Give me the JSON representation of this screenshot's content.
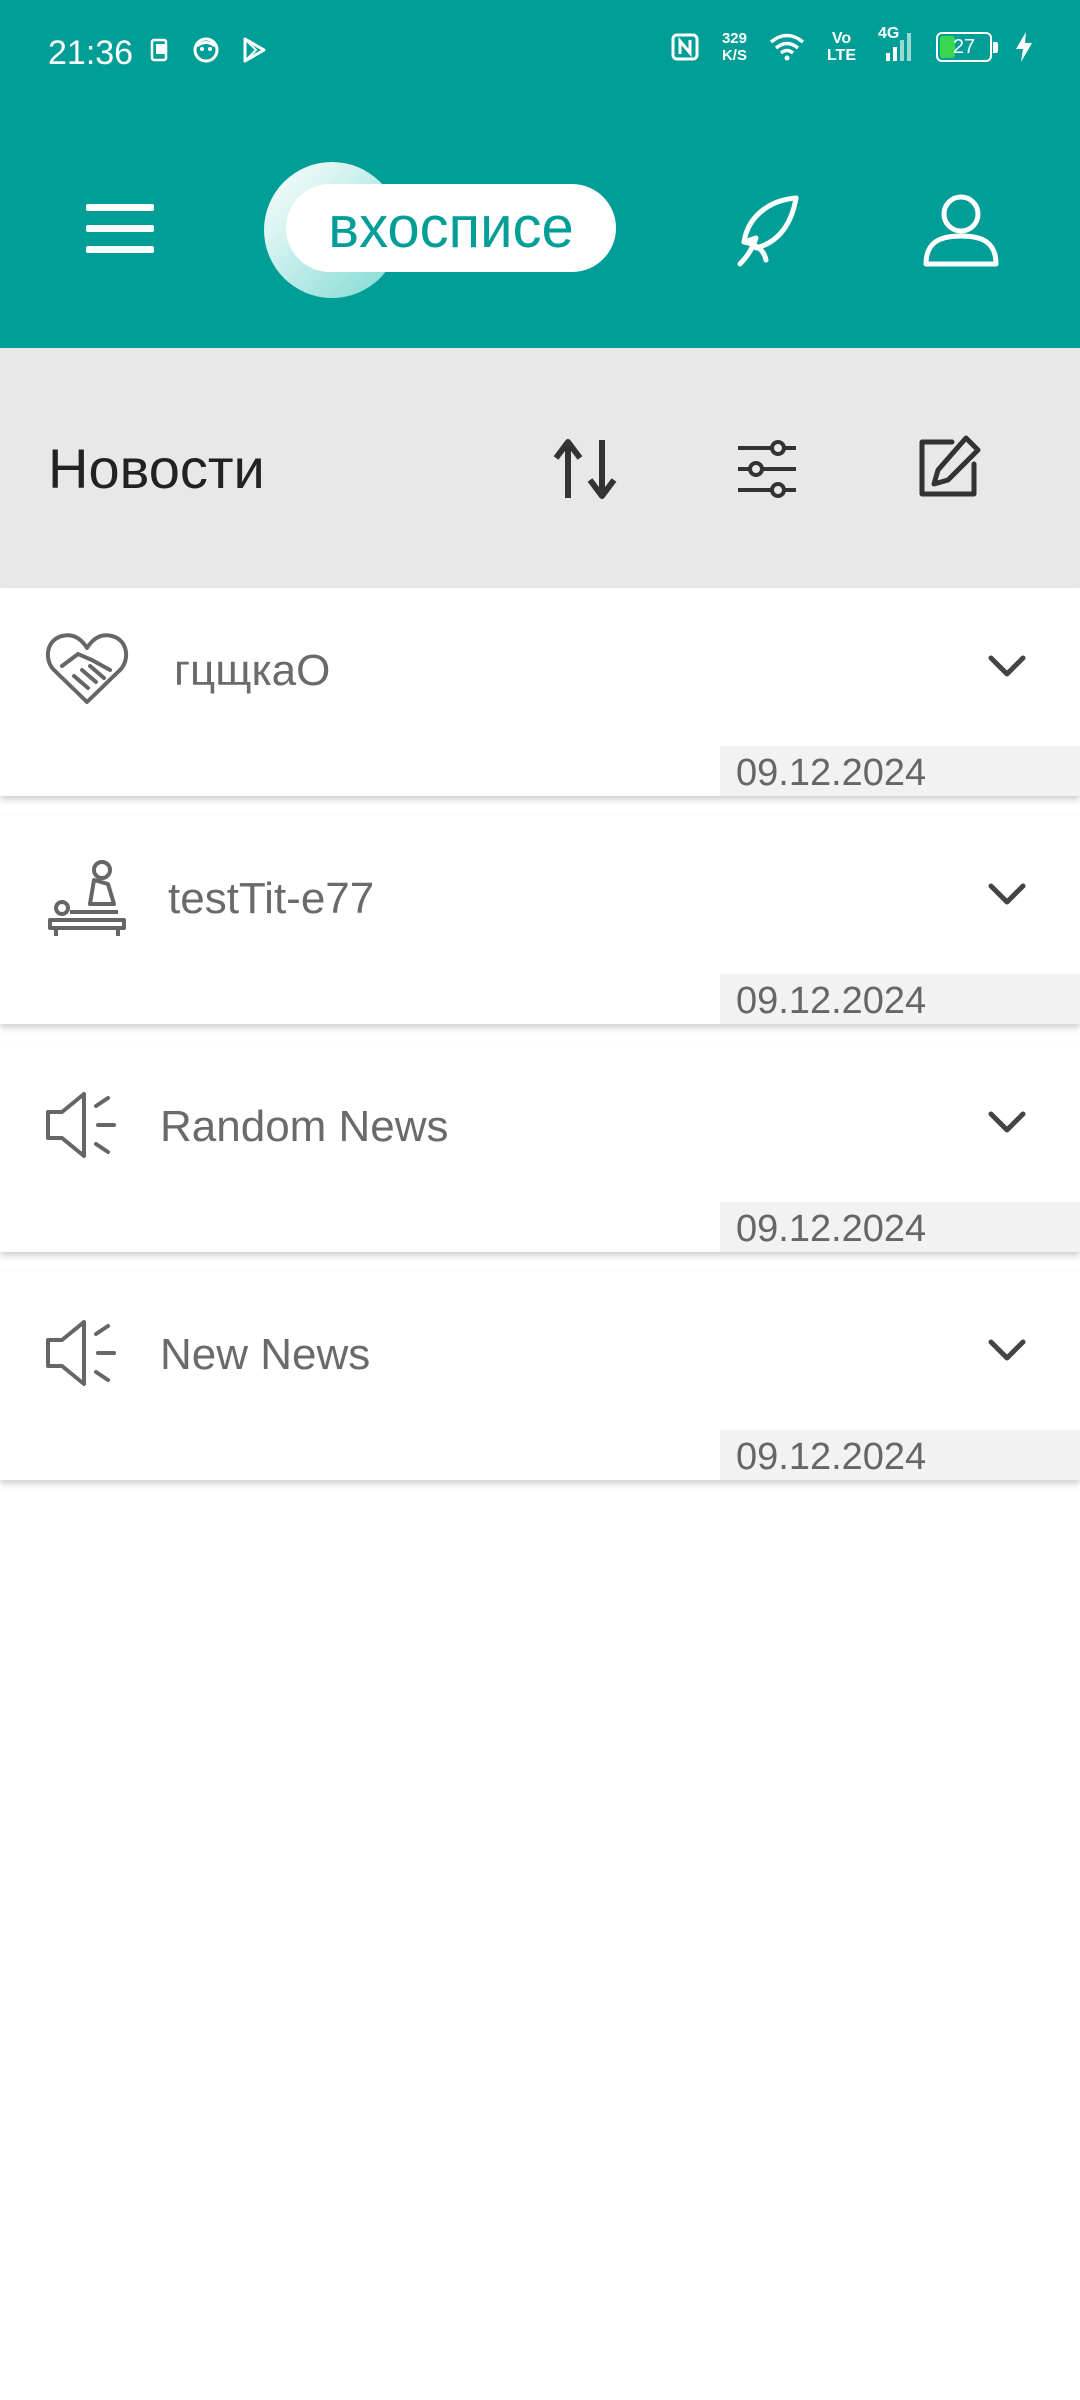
{
  "status_bar": {
    "time": "21:36",
    "net_speed_value": "329",
    "net_speed_unit": "K/S",
    "volte_top": "Vo",
    "volte_bottom": "LTE",
    "network": "4G",
    "battery_level": "27"
  },
  "app_bar": {
    "logo_text": "вхосписе",
    "icons": [
      "menu-icon",
      "feather-icon",
      "user-icon"
    ]
  },
  "toolbar": {
    "title": "Новости",
    "icons": [
      "sort-icon",
      "filter-icon",
      "edit-icon"
    ]
  },
  "news": [
    {
      "title": "гцщкаО",
      "date": "09.12.2024",
      "icon": "handshake-heart-icon"
    },
    {
      "title": "testTit-e77",
      "date": "09.12.2024",
      "icon": "massage-icon"
    },
    {
      "title": "Random News",
      "date": "09.12.2024",
      "icon": "megaphone-icon"
    },
    {
      "title": "New News",
      "date": "09.12.2024",
      "icon": "megaphone-icon"
    }
  ],
  "colors": {
    "primary": "#009e97",
    "toolbar_bg": "#e8e8e8",
    "text_muted": "#6a6a6a",
    "battery_green": "#39d64f"
  }
}
